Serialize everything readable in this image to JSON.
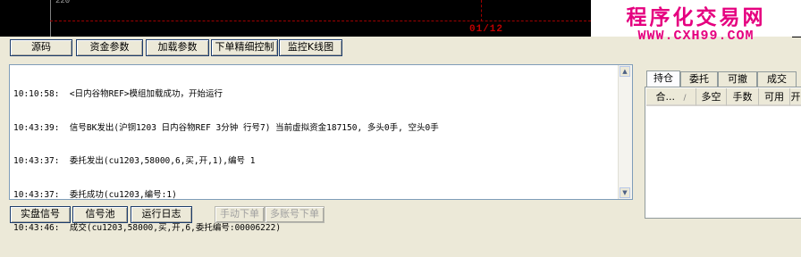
{
  "chart": {
    "axis_label": "220",
    "date_label": "01/12"
  },
  "watermark": {
    "line1": "程序化交易网",
    "line2": "WWW.CXH99.COM"
  },
  "toolbar": {
    "buttons": [
      "源码",
      "资金参数",
      "加载参数",
      "下单精细控制",
      "监控K线图"
    ]
  },
  "log": {
    "lines": [
      "10:10:58:  <日内谷物REF>模组加载成功，开始运行",
      "10:43:39:  信号BK发出(沪铜1203 日内谷物REF 3分钟 行号7) 当前虚拟资金187150, 多头0手, 空头0手",
      "10:43:37:  委托发出(cu1203,58000,6,买,开,1),编号 1",
      "10:43:37:  委托成功(cu1203,编号:1)",
      "10:43:46:  成交(cu1203,58000,买,开,6,委托编号:00006222)"
    ]
  },
  "bottom": {
    "buttons": [
      "实盘信号",
      "信号池",
      "运行日志"
    ],
    "disabled_buttons": [
      "手动下单",
      "多账号下单"
    ]
  },
  "panel": {
    "tabs": [
      "持仓",
      "委托",
      "可撤",
      "成交"
    ],
    "columns": [
      "合...",
      "多空",
      "手数",
      "可用",
      "开"
    ]
  }
}
